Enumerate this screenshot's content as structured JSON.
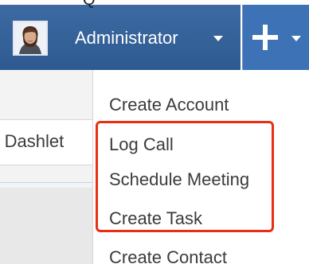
{
  "header": {
    "top_glyph": "Q",
    "user_name": "Administrator",
    "avatar_icon": "user-avatar",
    "user_caret_icon": "chevron-down-icon",
    "quick_create_icon": "plus-icon",
    "quick_create_caret_icon": "chevron-down-icon",
    "accent_color": "#3e72b6",
    "highlight_color": "#e82e13"
  },
  "dashboard": {
    "dashlet_label": "ar Dashlet"
  },
  "quick_create_menu": {
    "items": [
      "Create Account",
      "Log Call",
      "Schedule Meeting",
      "Create Task",
      "Create Contact"
    ]
  }
}
